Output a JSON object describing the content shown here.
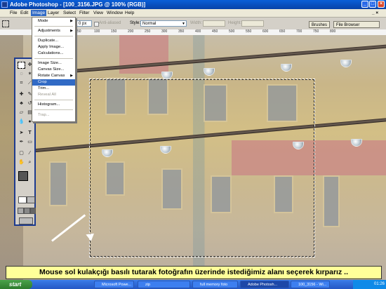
{
  "window": {
    "title": "Adobe Photoshop - [100_3156.JPG @ 100% (RGB)]"
  },
  "menubar": {
    "items": [
      "File",
      "Edit",
      "Image",
      "Layer",
      "Select",
      "Filter",
      "View",
      "Window",
      "Help"
    ]
  },
  "options": {
    "px_value": "0 px",
    "antialiased": "Anti-aliased",
    "style_label": "Style:",
    "style_value": "Normal",
    "width_label": "Width:",
    "height_label": "Height:"
  },
  "palette_tabs": [
    "Brushes",
    "File Browser"
  ],
  "ruler": {
    "ticks": [
      "50",
      "100",
      "150",
      "200",
      "250",
      "300",
      "350",
      "400",
      "450",
      "500",
      "550",
      "600",
      "650",
      "700",
      "750",
      "800"
    ]
  },
  "image_menu": {
    "items": [
      {
        "label": "Mode",
        "submenu": true
      },
      {
        "label": "Adjustments",
        "submenu": true
      },
      {
        "label": "Duplicate..."
      },
      {
        "label": "Apply Image..."
      },
      {
        "label": "Calculations..."
      },
      {
        "label": "Image Size..."
      },
      {
        "label": "Canvas Size..."
      },
      {
        "label": "Rotate Canvas",
        "submenu": true
      },
      {
        "label": "Crop",
        "selected": true
      },
      {
        "label": "Trim..."
      },
      {
        "label": "Reveal All",
        "disabled": true
      },
      {
        "label": "Histogram..."
      },
      {
        "label": "Trap...",
        "disabled": true
      }
    ]
  },
  "caption": "Mouse sol kulakçığı basılı tutarak fotoğrafın üzerinde istediğimiz alanı seçerek kırparız ..",
  "taskbar": {
    "start": "start",
    "buttons": [
      "Microsoft Powe...",
      "zip",
      "full memory foto",
      "Adobe Photosh...",
      "100_3156 - Wi..."
    ],
    "clock": "01:26"
  },
  "colors": {
    "accent": "#316ac5",
    "caption_bg": "#ffff99",
    "title_bar": "#0a5fd8",
    "taskbar": "#2457c5"
  }
}
